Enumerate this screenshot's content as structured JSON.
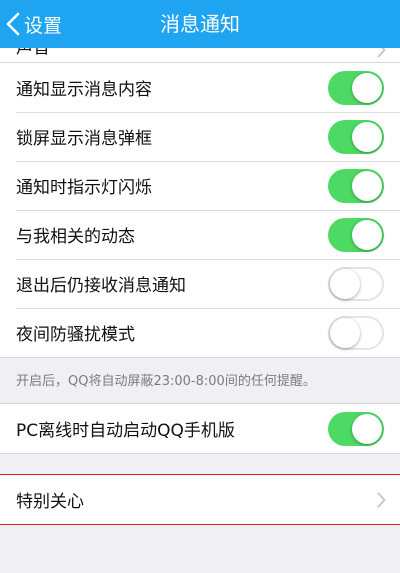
{
  "nav": {
    "back_label": "设置",
    "title": "消息通知"
  },
  "partial_item": {
    "label": "声音"
  },
  "group1": [
    {
      "label": "通知显示消息内容",
      "state": "on"
    },
    {
      "label": "锁屏显示消息弹框",
      "state": "on"
    },
    {
      "label": "通知时指示灯闪烁",
      "state": "on"
    },
    {
      "label": "与我相关的动态",
      "state": "on"
    },
    {
      "label": "退出后仍接收消息通知",
      "state": "off"
    },
    {
      "label": "夜间防骚扰模式",
      "state": "off"
    }
  ],
  "note": "开启后，QQ将自动屏蔽23:00-8:00间的任何提醒。",
  "group2": {
    "label": "PC离线时自动启动QQ手机版",
    "state": "on"
  },
  "group3": {
    "label": "特别关心"
  },
  "colors": {
    "nav_bg": "#1fa4f2",
    "toggle_on": "#4cd964",
    "highlight": "#e02020",
    "page_bg": "#efeff4"
  }
}
